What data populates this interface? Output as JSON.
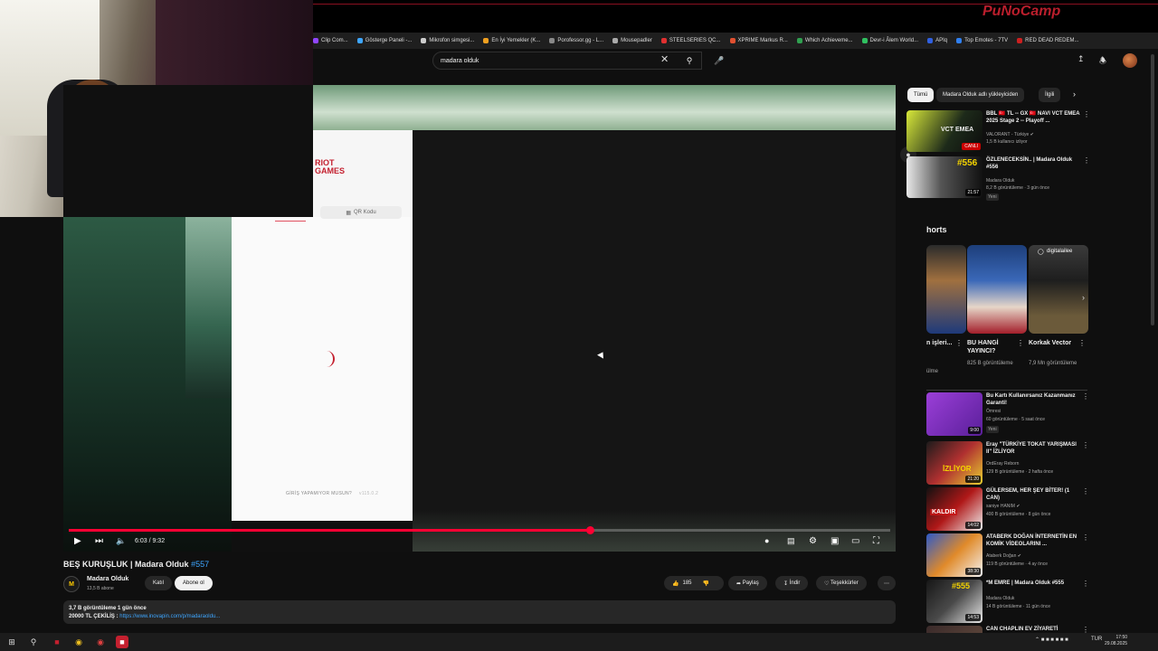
{
  "bookmarks": [
    {
      "label": "Clip Com...",
      "color": "#9146ff"
    },
    {
      "label": "Gösterge Paneli -...",
      "color": "#3ea6ff"
    },
    {
      "label": "Mikrofon simgesi...",
      "color": "#cccccc"
    },
    {
      "label": "En İyi Yemekler (K...",
      "color": "#f0a020"
    },
    {
      "label": "Porofessor.gg - L...",
      "color": "#888888"
    },
    {
      "label": "Mousepadler",
      "color": "#aaaaaa"
    },
    {
      "label": "STEELSERIES QC...",
      "color": "#e03030"
    },
    {
      "label": "XPRIME Markus R...",
      "color": "#e05030"
    },
    {
      "label": "Which Achieveme...",
      "color": "#30a050"
    },
    {
      "label": "Devr-i Âlem World...",
      "color": "#30c060"
    },
    {
      "label": "APIq",
      "color": "#3060e0"
    },
    {
      "label": "Top Emotes - 7TV",
      "color": "#3080f0"
    },
    {
      "label": "RED DEAD REDEM...",
      "color": "#cc2020"
    }
  ],
  "search": {
    "value": "madara olduk"
  },
  "login": {
    "brand": "RIOT GAMES",
    "qr_label": "QR Kodu",
    "footer": "GİRİŞ YAPAMIYOR MUSUN?",
    "version": "v115.0.2"
  },
  "player": {
    "time": "6:03 / 9:32",
    "progress": 0.634
  },
  "video": {
    "title": "BEŞ KURUŞLUK | Madara Olduk",
    "tag": "#557",
    "channel": "Madara Olduk",
    "subs": "13,5 B abone",
    "join": "Katıl",
    "subscribe": "Abone ol",
    "likes": "185",
    "share": "Paylaş",
    "download": "İndir",
    "thanks": "Teşekkürler",
    "desc_line1": "3,7 B görüntüleme  1 gün önce",
    "desc_line2_prefix": "20000 TL ÇEKİLİŞ : ",
    "desc_link": "https://www.inovapin.com/p/madaraoldu..."
  },
  "chips": [
    "Tümü",
    "Madara Olduk adlı yükleyiciden",
    "İlgili"
  ],
  "related_top": [
    {
      "title": "BBL 🇹🇷 TL -- GX 🇹🇷 NAVI VCT EMEA 2025 Stage 2 -- Playoff ...",
      "channel": "VALORANT - Türkiye ✔",
      "meta": "1,5 B kullanıcı izliyor",
      "badge": "",
      "dur": "",
      "live": "CANLI"
    },
    {
      "title": "ÖZLENECEKSİN.. | Madara Olduk #556",
      "channel": "Madara Olduk",
      "meta": "8,2 B görüntüleme · 3 gün önce",
      "badge": "Yeni",
      "dur": "21:57",
      "live": ""
    }
  ],
  "shorts_heading": "horts",
  "shorts": [
    {
      "title": "n işleri...",
      "views": "ülme"
    },
    {
      "title": "BU HANGİ YAYINCI?",
      "views": "825 B görüntüleme"
    },
    {
      "title": "Korkak Vector",
      "views": "7,9 Mn görüntüleme"
    }
  ],
  "short_handle": "digitalailee",
  "related_bottom": [
    {
      "title": "Bu Kartı Kullanırsanız Kazanmanız Garanti!",
      "channel": "Ömresi",
      "meta": "60 görüntüleme · 5 saat önce",
      "badge": "Yeni",
      "dur": "9:00"
    },
    {
      "title": "Eray \"TÜRKİYE TOKAT YARIŞMASI II\" İZLİYOR",
      "channel": "OrdEray Reborn",
      "meta": "129 B görüntüleme · 2 hafta önce",
      "badge": "",
      "dur": "21:20"
    },
    {
      "title": "GÜLERSEM, HER ŞEY BİTER! (1 CAN)",
      "channel": "saniye HANIM ✔",
      "meta": "400 B görüntüleme · 8 gün önce",
      "badge": "",
      "dur": "14:02"
    },
    {
      "title": "ATABERK DOĞAN İNTERNETİN EN KOMİK VİDEOLARINI ...",
      "channel": "Ataberk Doğan ✔",
      "meta": "119 B görüntüleme · 4 ay önce",
      "badge": "",
      "dur": "38:30"
    },
    {
      "title": "*M EMRE | Madara Olduk #555",
      "channel": "Madara Olduk",
      "meta": "14 B görüntüleme · 11 gün önce",
      "badge": "",
      "dur": "14:53"
    },
    {
      "title": "CAN CHAPLIN EV ZİYARETİ",
      "channel": "",
      "meta": "",
      "badge": "",
      "dur": ""
    }
  ],
  "thumb_texts": {
    "kaldir": "KALDIR",
    "izliyor": "İZLİYOR",
    "vct": "VCT EMEA",
    "n556": "#556",
    "n555": "#555"
  },
  "taskbar": {
    "lang": "TUR",
    "time": "17:50",
    "date": "29.08.2025"
  },
  "brand_logo": "PuNoCamp",
  "colors": {
    "yt_red": "#ff0033",
    "riot_red": "#c4202f",
    "link": "#3ea6ff"
  }
}
